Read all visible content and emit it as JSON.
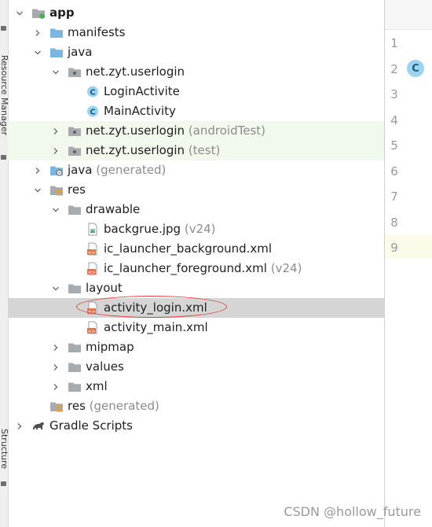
{
  "side_tabs": {
    "resource_manager": "Resource Manager",
    "structure": "Structure"
  },
  "tree": [
    {
      "id": "app",
      "indent": 0,
      "chevron": "down",
      "icon": "module-folder-icon",
      "label": "app",
      "bold": true
    },
    {
      "id": "manifests",
      "indent": 1,
      "chevron": "right",
      "icon": "blue-folder-icon",
      "label": "manifests"
    },
    {
      "id": "java",
      "indent": 1,
      "chevron": "down",
      "icon": "blue-folder-icon",
      "label": "java"
    },
    {
      "id": "pkg-main",
      "indent": 2,
      "chevron": "down",
      "icon": "package-icon",
      "label": "net.zyt.userlogin"
    },
    {
      "id": "login-activite",
      "indent": 3,
      "chevron": "",
      "icon": "class-icon",
      "label": "LoginActivite"
    },
    {
      "id": "main-activity",
      "indent": 3,
      "chevron": "",
      "icon": "class-icon",
      "label": "MainActivity"
    },
    {
      "id": "pkg-androidtest",
      "indent": 2,
      "chevron": "right",
      "icon": "package-icon",
      "label": "net.zyt.userlogin",
      "suffix": "(androidTest)",
      "highlight": true
    },
    {
      "id": "pkg-test",
      "indent": 2,
      "chevron": "right",
      "icon": "package-icon",
      "label": "net.zyt.userlogin",
      "suffix": "(test)",
      "highlight": true
    },
    {
      "id": "java-generated",
      "indent": 1,
      "chevron": "right",
      "icon": "java-generated-icon",
      "label": "java",
      "suffix": "(generated)"
    },
    {
      "id": "res",
      "indent": 1,
      "chevron": "down",
      "icon": "res-folder-icon",
      "label": "res"
    },
    {
      "id": "drawable",
      "indent": 2,
      "chevron": "down",
      "icon": "gray-folder-icon",
      "label": "drawable"
    },
    {
      "id": "backgrue",
      "indent": 3,
      "chevron": "",
      "icon": "image-file-icon",
      "label": "backgrue.jpg",
      "suffix": "(v24)"
    },
    {
      "id": "ic-bg",
      "indent": 3,
      "chevron": "",
      "icon": "xml-file-icon",
      "label": "ic_launcher_background.xml"
    },
    {
      "id": "ic-fg",
      "indent": 3,
      "chevron": "",
      "icon": "xml-file-icon",
      "label": "ic_launcher_foreground.xml",
      "suffix": "(v24)"
    },
    {
      "id": "layout",
      "indent": 2,
      "chevron": "down",
      "icon": "gray-folder-icon",
      "label": "layout"
    },
    {
      "id": "activity-login",
      "indent": 3,
      "chevron": "",
      "icon": "xml-file-icon",
      "label": "activity_login.xml",
      "selected": true
    },
    {
      "id": "activity-main",
      "indent": 3,
      "chevron": "",
      "icon": "xml-file-icon",
      "label": "activity_main.xml"
    },
    {
      "id": "mipmap",
      "indent": 2,
      "chevron": "right",
      "icon": "gray-folder-icon",
      "label": "mipmap"
    },
    {
      "id": "values",
      "indent": 2,
      "chevron": "right",
      "icon": "gray-folder-icon",
      "label": "values"
    },
    {
      "id": "xml",
      "indent": 2,
      "chevron": "right",
      "icon": "gray-folder-icon",
      "label": "xml"
    },
    {
      "id": "res-generated",
      "indent": 1,
      "chevron": "",
      "icon": "res-folder-icon",
      "label": "res",
      "suffix": "(generated)"
    },
    {
      "id": "gradle-scripts",
      "indent": 0,
      "chevron": "right",
      "icon": "gradle-icon",
      "label": "Gradle Scripts"
    }
  ],
  "editor": {
    "line_numbers": [
      "1",
      "2",
      "3",
      "4",
      "5",
      "6",
      "7",
      "8",
      "9"
    ],
    "class_badge": "C"
  },
  "watermark": "CSDN @hollow_future",
  "colors": {
    "highlight_row": "#f1f8ec",
    "selected_row": "#d5d5d5",
    "annotation": "#e04040",
    "class_icon": "#9ad4f0",
    "folder_blue": "#7bb6e0",
    "folder_gray": "#a7abb0"
  }
}
